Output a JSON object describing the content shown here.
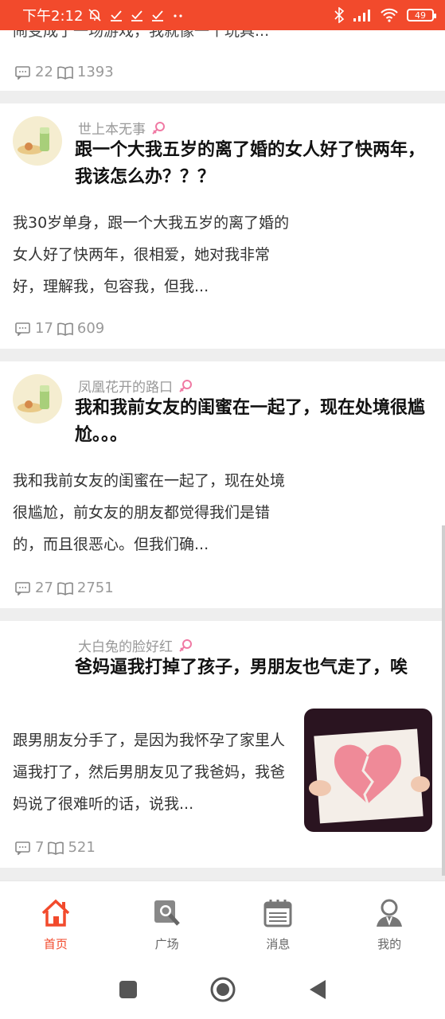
{
  "status_bar": {
    "time": "下午2:12",
    "battery": "49"
  },
  "feed": {
    "partial_card": {
      "cut_text": "闹变成了一场游戏，我就像一个玩具...",
      "comments": "22",
      "reads": "1393"
    },
    "posts": [
      {
        "author": "世上本无事",
        "title": "跟一个大我五岁的离了婚的女人好了快两年，我该怎么办？？？",
        "excerpt": "我30岁单身，跟一个大我五岁的离了婚的女人好了快两年，很相爱，她对我非常好，理解我，包容我，但我...",
        "comments": "17",
        "reads": "609"
      },
      {
        "author": "凤凰花开的路口",
        "title": "我和我前女友的闺蜜在一起了，现在处境很尴尬。。。",
        "excerpt": "我和我前女友的闺蜜在一起了，现在处境很尴尬，前女友的朋友都觉得我们是错的，而且很恶心。但我们确...",
        "comments": "27",
        "reads": "2751"
      },
      {
        "author": "大白兔的脸好红",
        "title": "爸妈逼我打掉了孩子，男朋友也气走了，唉",
        "excerpt": "跟男朋友分手了，是因为我怀孕了家里人逼我打了，然后男朋友见了我爸妈，我爸妈说了很难听的话，说我...",
        "comments": "7",
        "reads": "521"
      }
    ]
  },
  "tabbar": {
    "items": [
      {
        "label": "首页",
        "icon": "home-icon"
      },
      {
        "label": "广场",
        "icon": "magnifier-icon"
      },
      {
        "label": "消息",
        "icon": "calendar-icon"
      },
      {
        "label": "我的",
        "icon": "person-icon"
      }
    ],
    "active_color": "#f24a2c"
  },
  "colors": {
    "accent": "#f24a2c",
    "gender_female": "#f07aa4"
  }
}
